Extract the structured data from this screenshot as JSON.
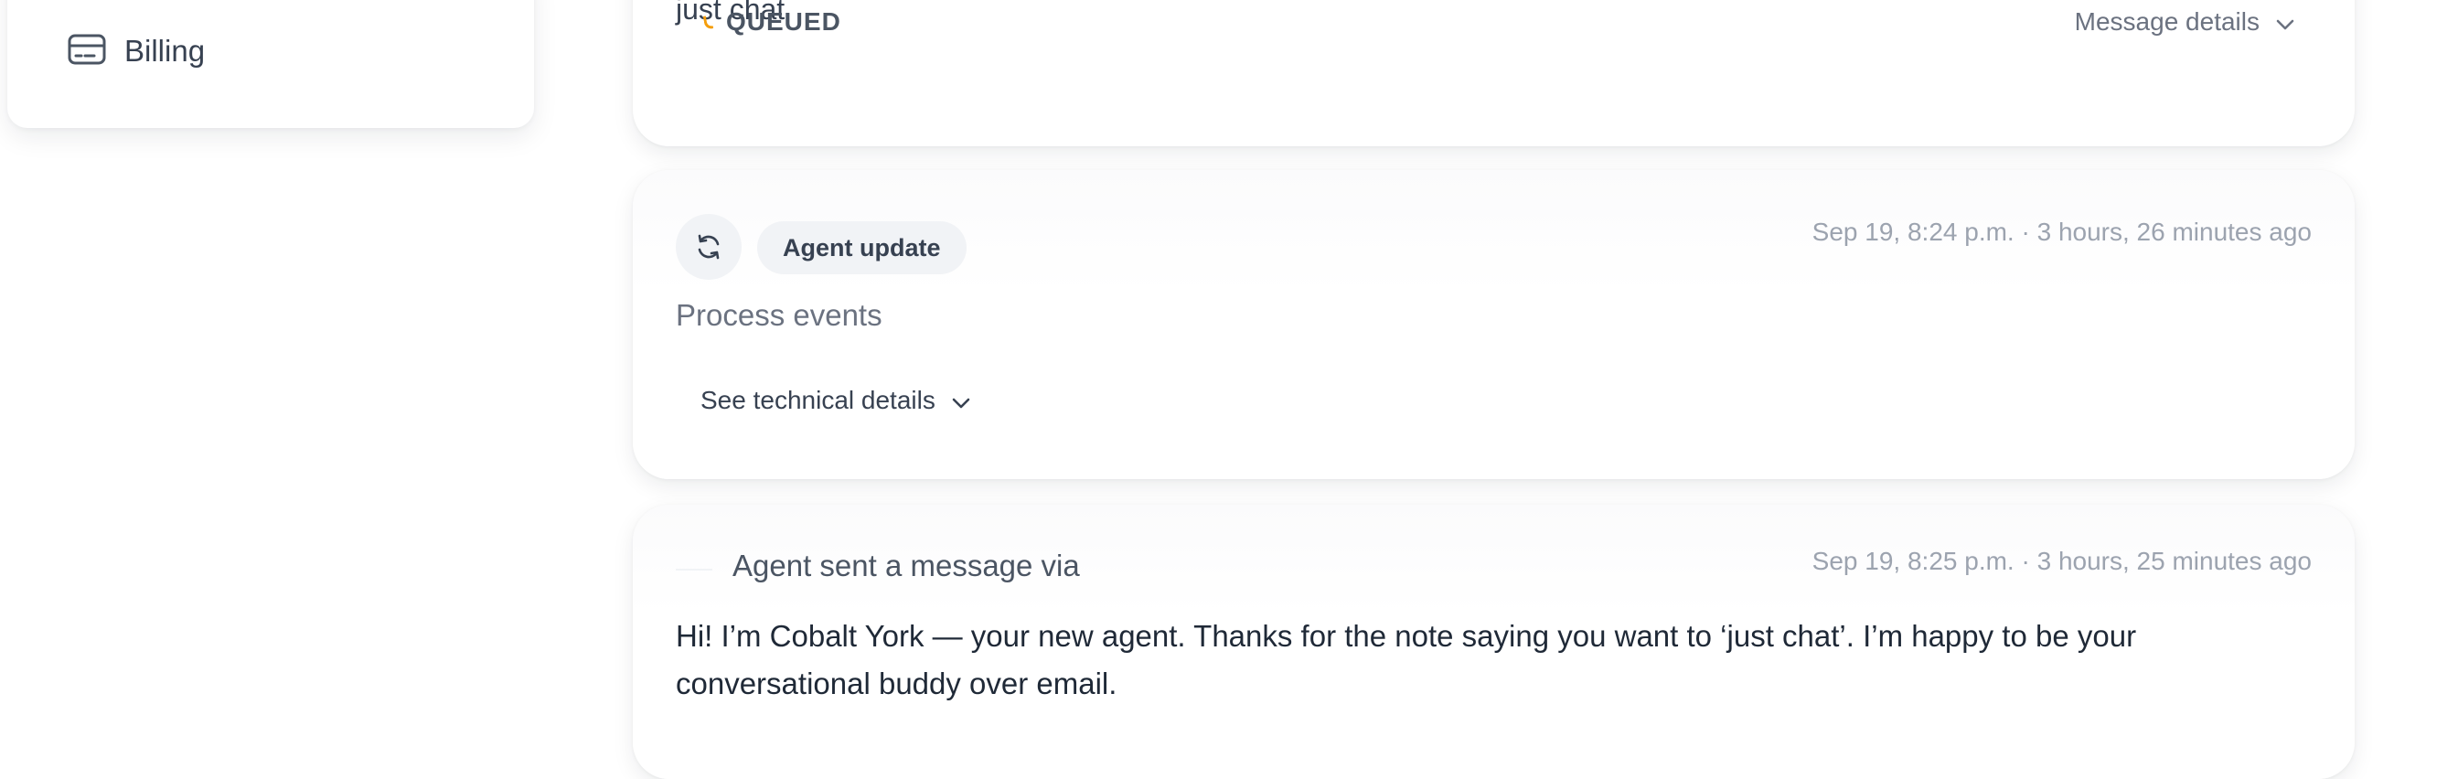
{
  "sidebar": {
    "items": [
      {
        "label": "Billing",
        "icon": "credit-card-icon"
      }
    ]
  },
  "feed": {
    "message_card": {
      "clipped_text": "just chat",
      "status_label": "QUEUED",
      "status_color": "#f59e0b",
      "details_label": "Message details"
    },
    "update_card": {
      "badge_label": "Agent update",
      "icon": "refresh-icon",
      "timestamp": "Sep 19, 8:24 p.m. · 3 hours, 26 minutes ago",
      "title": "Process events",
      "details_label": "See technical details"
    },
    "sent_card": {
      "sender_label": "Agent sent a message via",
      "timestamp": "Sep 19, 8:25 p.m. · 3 hours, 25 minutes ago",
      "body": "Hi! I’m Cobalt York — your new agent. Thanks for the note saying you want to ‘just chat’. I’m happy to be your conversational buddy over email."
    }
  }
}
